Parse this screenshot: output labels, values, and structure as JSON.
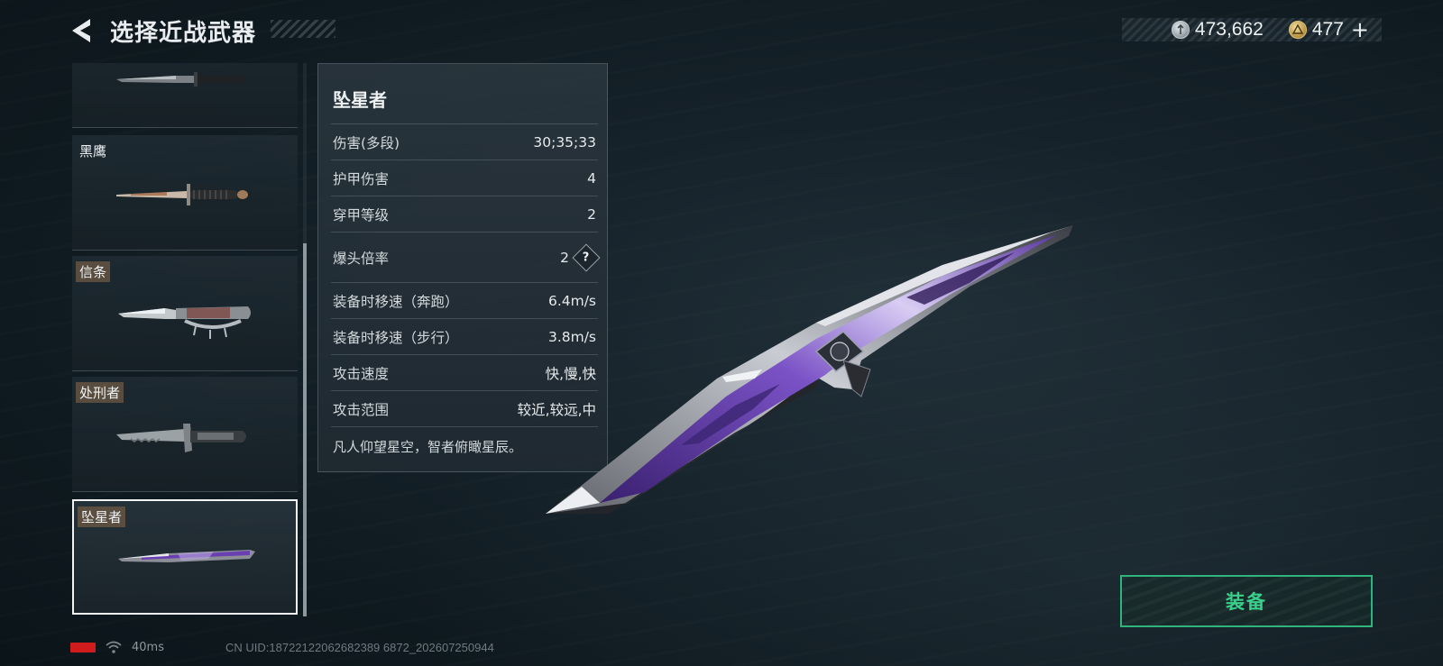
{
  "header": {
    "title": "选择近战武器",
    "currency_silver": "473,662",
    "currency_gold": "477",
    "add_label": "+"
  },
  "weapon_list": {
    "items": [
      {
        "name": "",
        "style": "plain"
      },
      {
        "name": "黑鹰",
        "style": "plain"
      },
      {
        "name": "信条",
        "style": "tag"
      },
      {
        "name": "处刑者",
        "style": "tag"
      },
      {
        "name": "坠星者",
        "style": "tag",
        "selected": true
      }
    ]
  },
  "stats": {
    "weapon_name": "坠星者",
    "rows": [
      {
        "label": "伤害(多段)",
        "value": "30;35;33"
      },
      {
        "label": "护甲伤害",
        "value": "4"
      },
      {
        "label": "穿甲等级",
        "value": "2"
      },
      {
        "label": "爆头倍率",
        "value": "2",
        "help": "?"
      },
      {
        "label": "装备时移速（奔跑）",
        "value": "6.4m/s"
      },
      {
        "label": "装备时移速（步行）",
        "value": "3.8m/s"
      },
      {
        "label": "攻击速度",
        "value": "快,慢,快"
      },
      {
        "label": "攻击范围",
        "value": "较近,较远,中"
      }
    ],
    "description": "凡人仰望星空，智者俯瞰星辰。"
  },
  "equip": {
    "label": "装备"
  },
  "footer": {
    "ping": "40ms",
    "uid": "CN UID:18722122062682389 6872_202607250944"
  },
  "colors": {
    "accent_green": "#3ad08c",
    "battery_red": "#d01c1c",
    "blade_purple": "#6a3fb0"
  },
  "icons": [
    "back-arrow-icon",
    "silver-coin-icon",
    "gold-coin-icon",
    "help-icon",
    "battery-icon",
    "wifi-icon"
  ]
}
